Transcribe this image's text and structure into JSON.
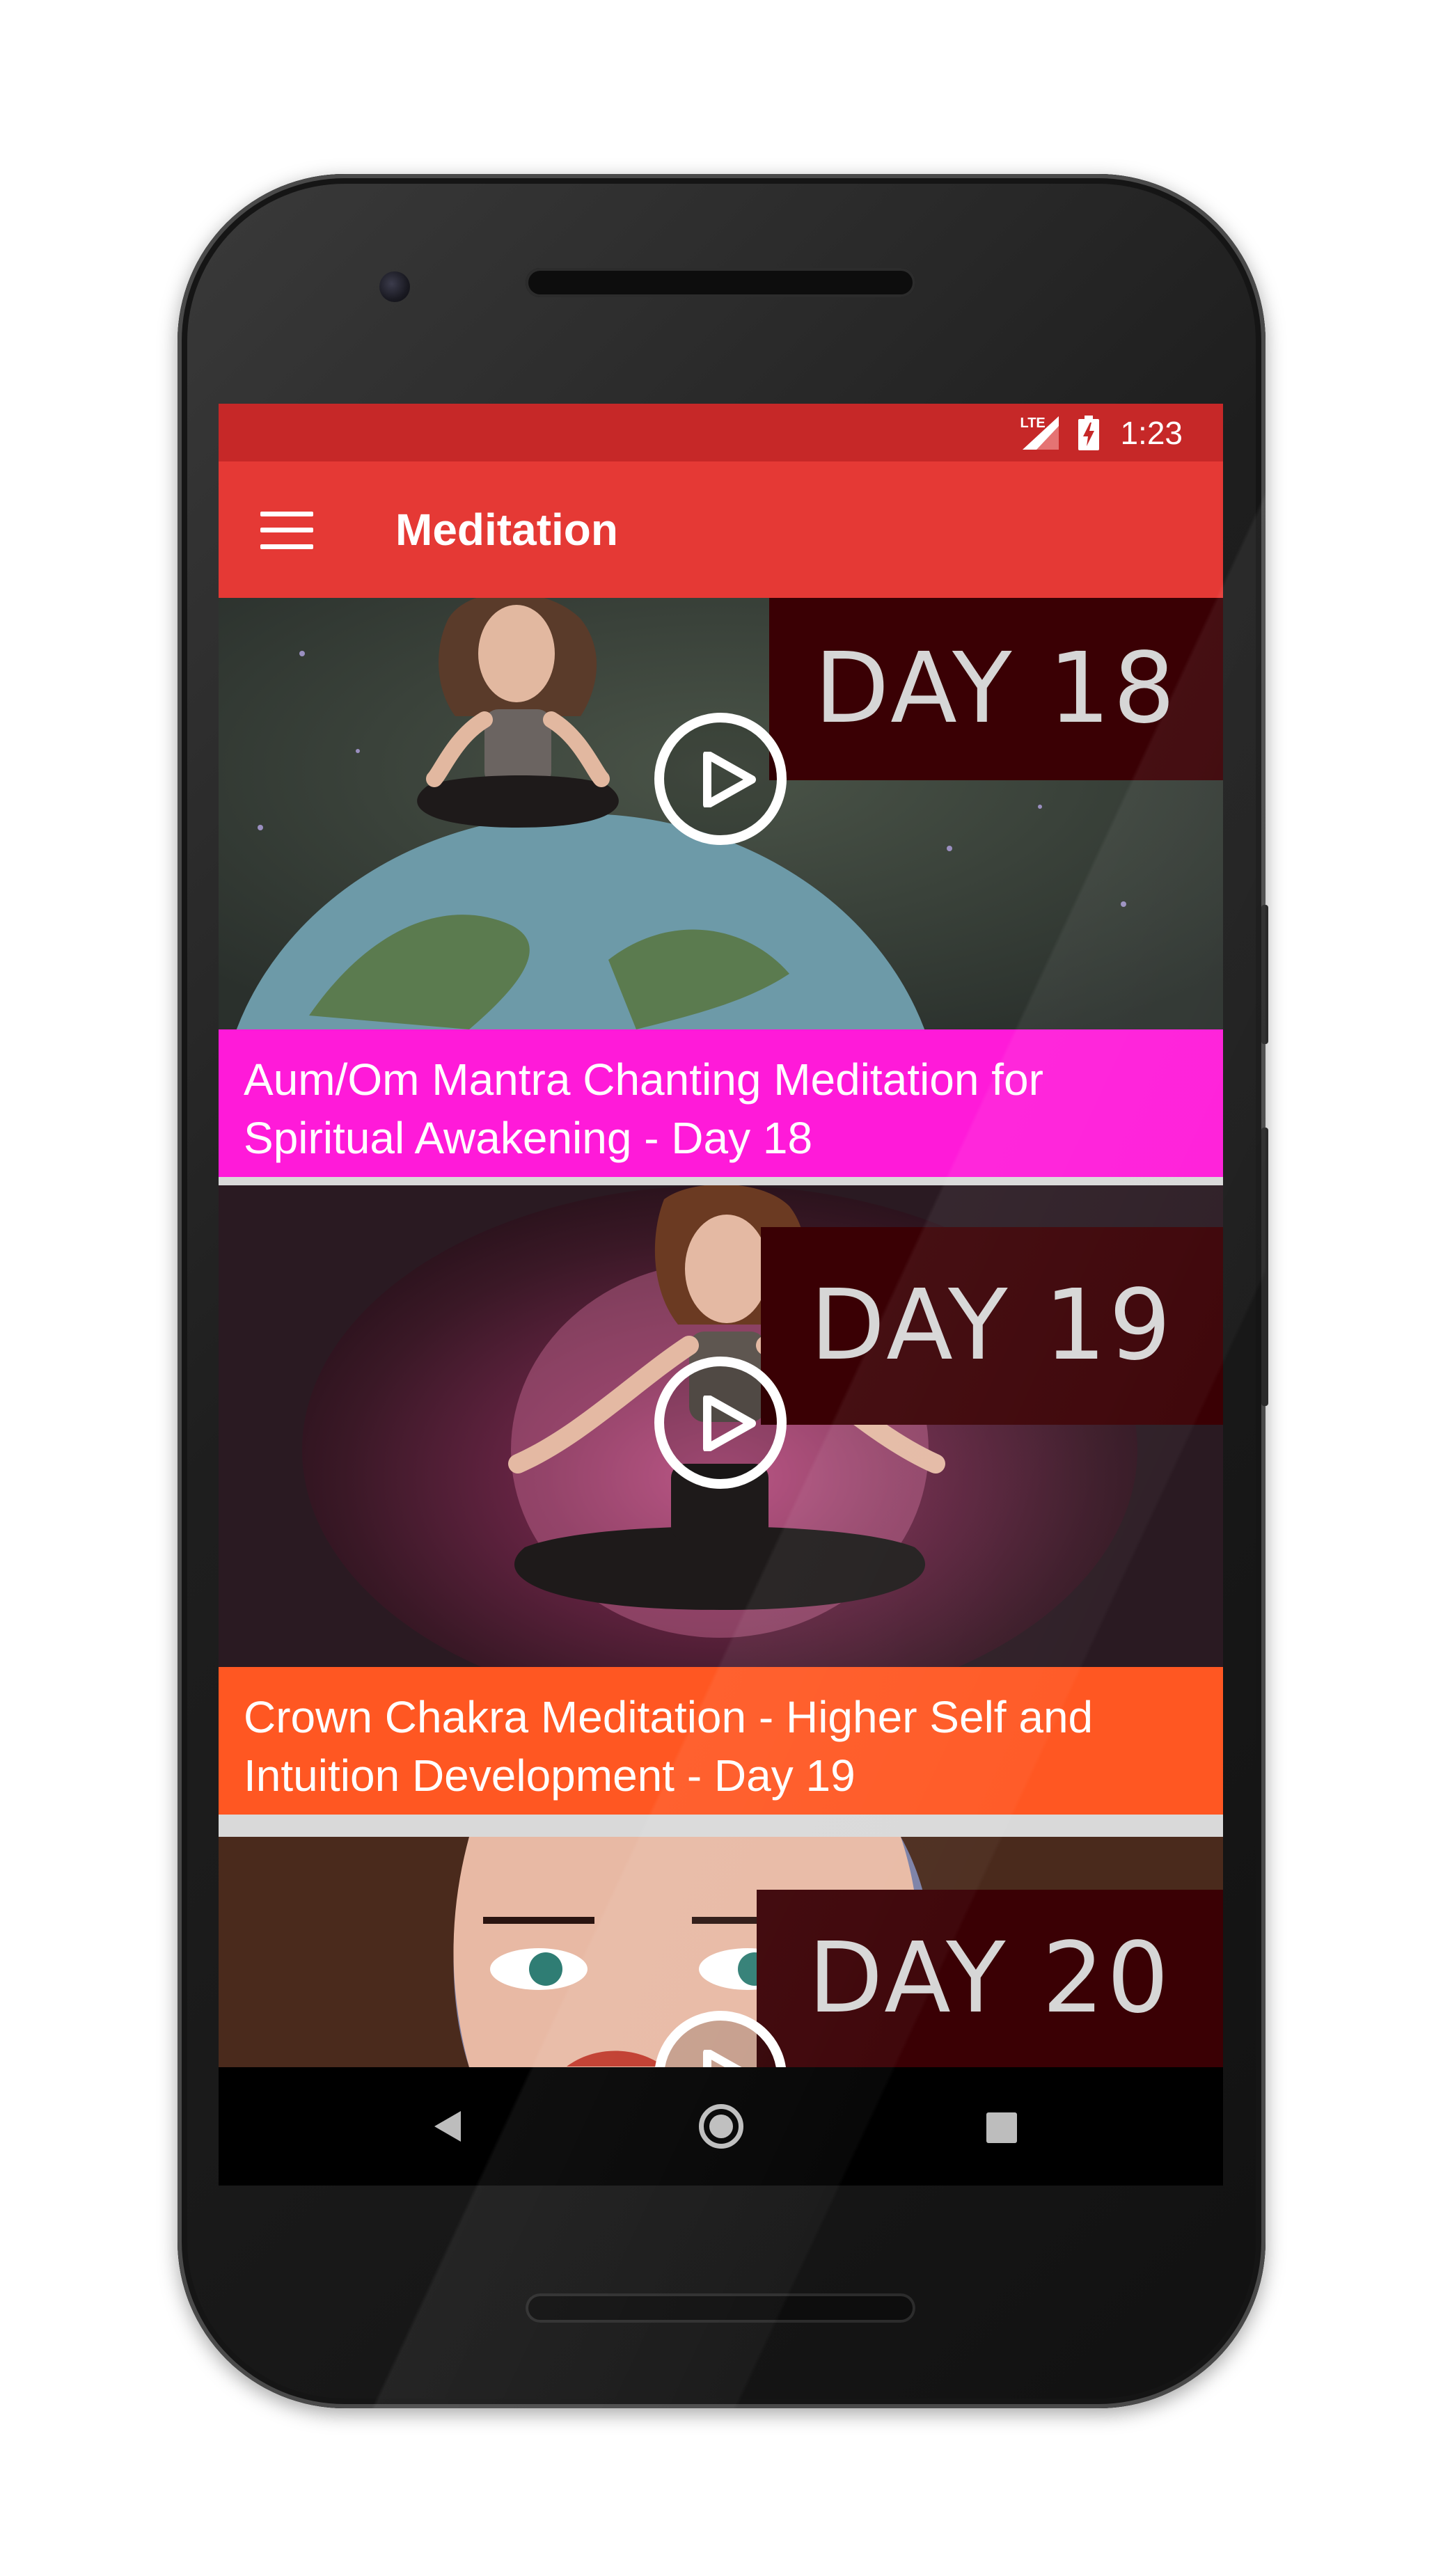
{
  "status_bar": {
    "network": "LTE",
    "time": "1:23"
  },
  "app_bar": {
    "title": "Meditation",
    "menu_icon": "hamburger-menu-icon"
  },
  "videos": [
    {
      "day_label": "DAY 18",
      "title": "Aum/Om Mantra Chanting Meditation for Spiritual Awakening - Day 18",
      "caption_color": "#ff1ad9",
      "play_icon": "play-circle-icon"
    },
    {
      "day_label": "DAY 19",
      "title": "Crown Chakra Meditation - Higher Self and Intuition Development - Day 19",
      "caption_color": "#ff5722",
      "play_icon": "play-circle-icon"
    },
    {
      "day_label": "DAY 20",
      "play_icon": "play-circle-icon"
    }
  ],
  "nav_bar": {
    "back_icon": "back-triangle-icon",
    "home_icon": "home-circle-icon",
    "recents_icon": "recents-square-icon"
  },
  "colors": {
    "status_bar": "#c62828",
    "app_bar": "#e53935",
    "day_banner": "#3a0004"
  }
}
